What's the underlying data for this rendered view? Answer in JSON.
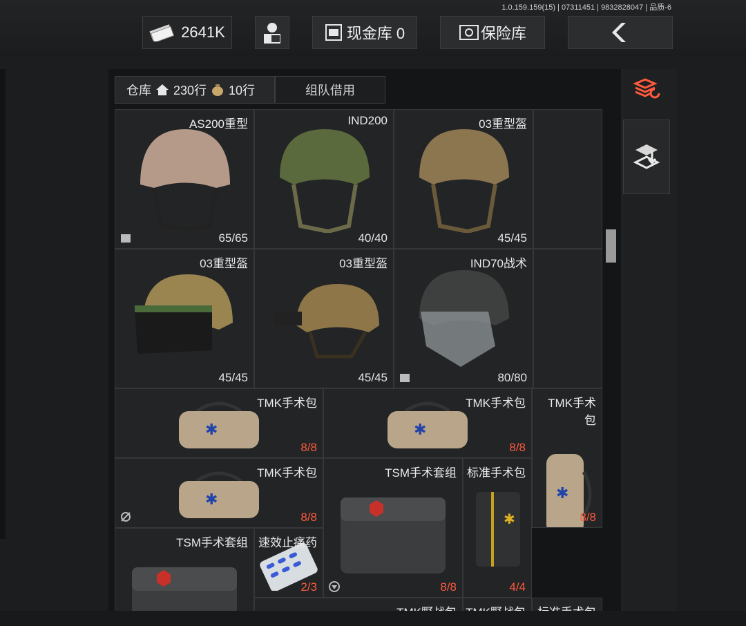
{
  "version_text": "1.0.159.159(15) | 07311451 | 9832828047 | 品质-6",
  "topbar": {
    "money_label": "2641K",
    "vault_label": "现金库 0",
    "safe_label": "保险库"
  },
  "tabs": {
    "warehouse": "仓库",
    "rows_label": "230行",
    "bag_rows_label": "10行",
    "team_borrow": "组队借用"
  },
  "items": [
    {
      "name": "AS200重型",
      "count": "65/65"
    },
    {
      "name": "IND200",
      "count": "40/40"
    },
    {
      "name": "03重型盔",
      "count": "45/45"
    },
    {
      "name": "03重型盔",
      "count": "45/45"
    },
    {
      "name": "03重型盔",
      "count": "45/45"
    },
    {
      "name": "IND70战术",
      "count": "80/80"
    },
    {
      "name": "TMK手术包",
      "count": "8/8"
    },
    {
      "name": "TMK手术包",
      "count": "8/8"
    },
    {
      "name": "TMK手术包",
      "count": "8/8"
    },
    {
      "name": "TMK手术包",
      "count": "8/8"
    },
    {
      "name": "TSM手术套组",
      "count": "8/8"
    },
    {
      "name": "标准手术包",
      "count": "4/4"
    },
    {
      "name": "TSM手术套组",
      "count": ""
    },
    {
      "name": "速效止痛药",
      "count": "2/3"
    },
    {
      "name": "TMK野战包",
      "count": ""
    },
    {
      "name": "TMK野战包",
      "count": ""
    },
    {
      "name": "标准手术包",
      "count": ""
    }
  ],
  "colors": {
    "accent": "#ff5a3c",
    "panel": "#141516",
    "cell": "#222426"
  }
}
